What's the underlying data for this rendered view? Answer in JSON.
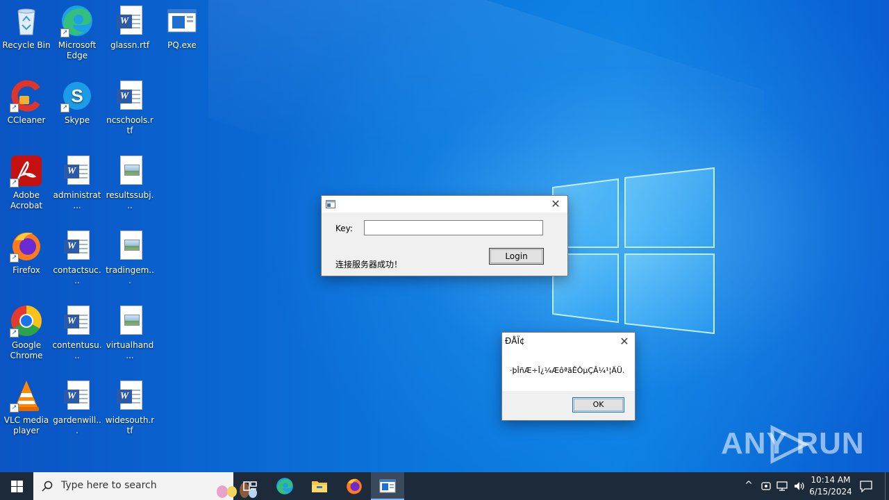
{
  "desktop": {
    "icons": [
      {
        "label": "Recycle Bin",
        "icon": "recycle-bin-icon"
      },
      {
        "label": "Microsoft Edge",
        "icon": "edge-icon"
      },
      {
        "label": "glassn.rtf",
        "icon": "word-document-icon"
      },
      {
        "label": "PQ.exe",
        "icon": "application-window-icon"
      },
      {
        "label": "CCleaner",
        "icon": "ccleaner-icon"
      },
      {
        "label": "Skype",
        "icon": "skype-icon"
      },
      {
        "label": "ncschools.rtf",
        "icon": "word-document-icon"
      },
      {
        "label": "Adobe Acrobat",
        "icon": "acrobat-icon"
      },
      {
        "label": "administrat...",
        "icon": "word-document-icon"
      },
      {
        "label": "resultssubj...",
        "icon": "image-file-icon"
      },
      {
        "label": "Firefox",
        "icon": "firefox-icon"
      },
      {
        "label": "contactsuc...",
        "icon": "word-document-icon"
      },
      {
        "label": "tradingem...",
        "icon": "image-file-icon"
      },
      {
        "label": "Google Chrome",
        "icon": "chrome-icon"
      },
      {
        "label": "contentusu...",
        "icon": "word-document-icon"
      },
      {
        "label": "virtualhand...",
        "icon": "image-file-icon"
      },
      {
        "label": "VLC media player",
        "icon": "vlc-icon"
      },
      {
        "label": "gardenwill...",
        "icon": "word-document-icon"
      },
      {
        "label": "widesouth.rtf",
        "icon": "word-document-icon"
      }
    ],
    "watermark": "ANY RUN"
  },
  "login_dialog": {
    "title": "",
    "key_label": "Key:",
    "key_value": "",
    "login_button": "Login",
    "status_text": "连接服务器成功！"
  },
  "message_dialog": {
    "title": "ÐÅÏ¢",
    "message": "·þÎñÆ÷Î¿¼ÆôªãÊÔµÇÂ¼¹¦ÄÜ.",
    "ok_button": "OK"
  },
  "taskbar": {
    "search_placeholder": "Type here to search",
    "time": "10:14 AM",
    "date": "6/15/2024",
    "pinned": [
      "task-view-icon",
      "edge-icon",
      "file-explorer-icon",
      "firefox-icon",
      "pq-app-icon"
    ]
  },
  "colors": {
    "desktop_blue": "#0b74db",
    "taskbar": "#1c2a3a",
    "dialog_bg": "#f0f0f0"
  }
}
